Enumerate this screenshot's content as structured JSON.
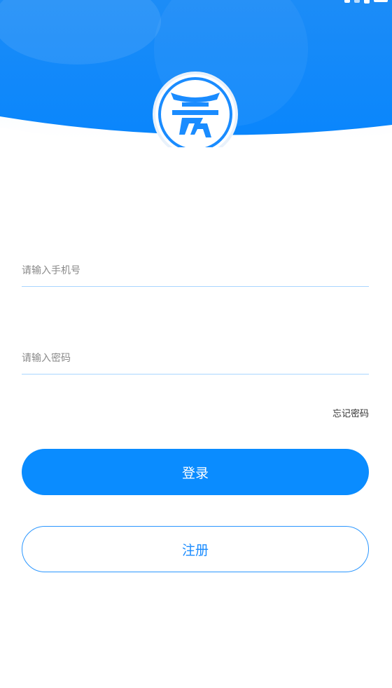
{
  "login_form": {
    "phone_placeholder": "请输入手机号",
    "password_placeholder": "请输入密码",
    "forgot_password": "忘记密码",
    "login_label": "登录",
    "register_label": "注册"
  },
  "colors": {
    "primary": "#0a8cff",
    "header_gradient_top": "#1e90ff",
    "input_underline": "#a9d6ff"
  },
  "icons": {
    "logo": "gate-emblem-logo",
    "status_bar": [
      "wifi-icon",
      "signal-icon",
      "battery-icon"
    ]
  }
}
